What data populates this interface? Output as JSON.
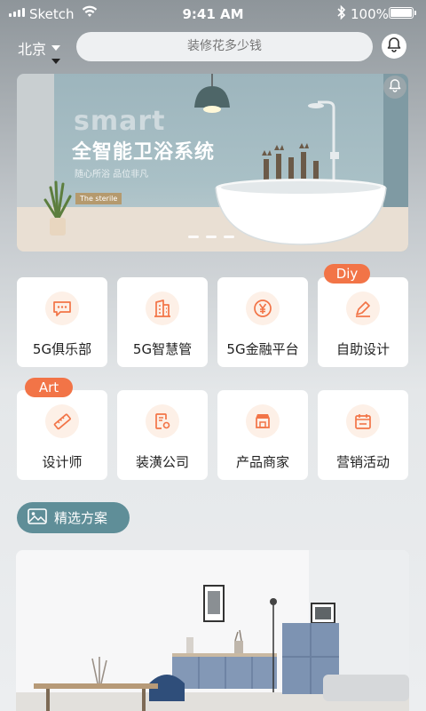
{
  "status_bar": {
    "carrier": "Sketch",
    "time": "9:41 AM",
    "battery": "100%"
  },
  "header": {
    "city": "北京",
    "search_placeholder": "装修花多少钱"
  },
  "banner": {
    "brand": "smart",
    "title": "全智能卫浴系统",
    "subtitle": "随心所浴  品位非凡",
    "tag": "The sterile",
    "pages": 3
  },
  "grid": {
    "row1": [
      {
        "label": "5G俱乐部",
        "icon": "chat-icon"
      },
      {
        "label": "5G智慧管",
        "icon": "building-icon"
      },
      {
        "label": "5G金融平台",
        "icon": "yen-icon"
      },
      {
        "label": "自助设计",
        "icon": "pen-icon",
        "badge": "Diy"
      }
    ],
    "row2": [
      {
        "label": "设计师",
        "icon": "ruler-icon",
        "badge": "Art"
      },
      {
        "label": "装潢公司",
        "icon": "document-gear-icon"
      },
      {
        "label": "产品商家",
        "icon": "shop-icon"
      },
      {
        "label": "营销活动",
        "icon": "calendar-icon"
      }
    ]
  },
  "section": {
    "label": "精选方案",
    "icon": "image-icon"
  },
  "colors": {
    "accent": "#f27447",
    "pill": "#5f8e98",
    "icon_bg": "#fdf0e7"
  }
}
